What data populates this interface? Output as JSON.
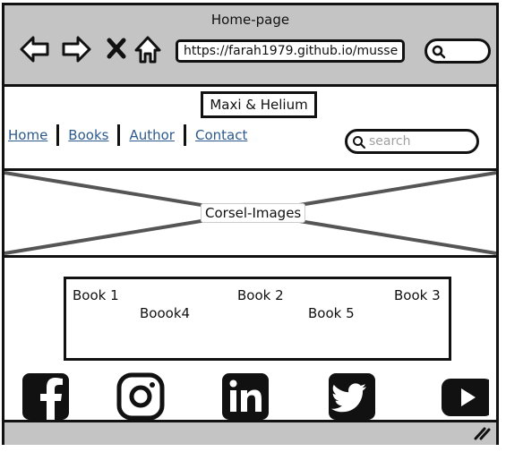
{
  "window": {
    "title": "Home-page",
    "url": "https://farah1979.github.io/musse"
  },
  "toolbar": {
    "icons": [
      "back-arrow-icon",
      "forward-arrow-icon",
      "close-x-icon",
      "home-icon",
      "search-icon"
    ]
  },
  "header": {
    "brand": "Maxi  &  Helium",
    "nav": [
      {
        "label": "Home"
      },
      {
        "label": "Books"
      },
      {
        "label": "Author"
      },
      {
        "label": "Contact"
      }
    ],
    "search_placeholder": "search"
  },
  "carousel": {
    "label": "Corsel-Images"
  },
  "books": [
    {
      "label": "Book 1"
    },
    {
      "label": "Book 2"
    },
    {
      "label": "Book 3"
    },
    {
      "label": "Boook4"
    },
    {
      "label": "Book 5"
    }
  ],
  "social": [
    "facebook-icon",
    "instagram-icon",
    "linkedin-icon",
    "twitter-icon",
    "youtube-icon"
  ]
}
